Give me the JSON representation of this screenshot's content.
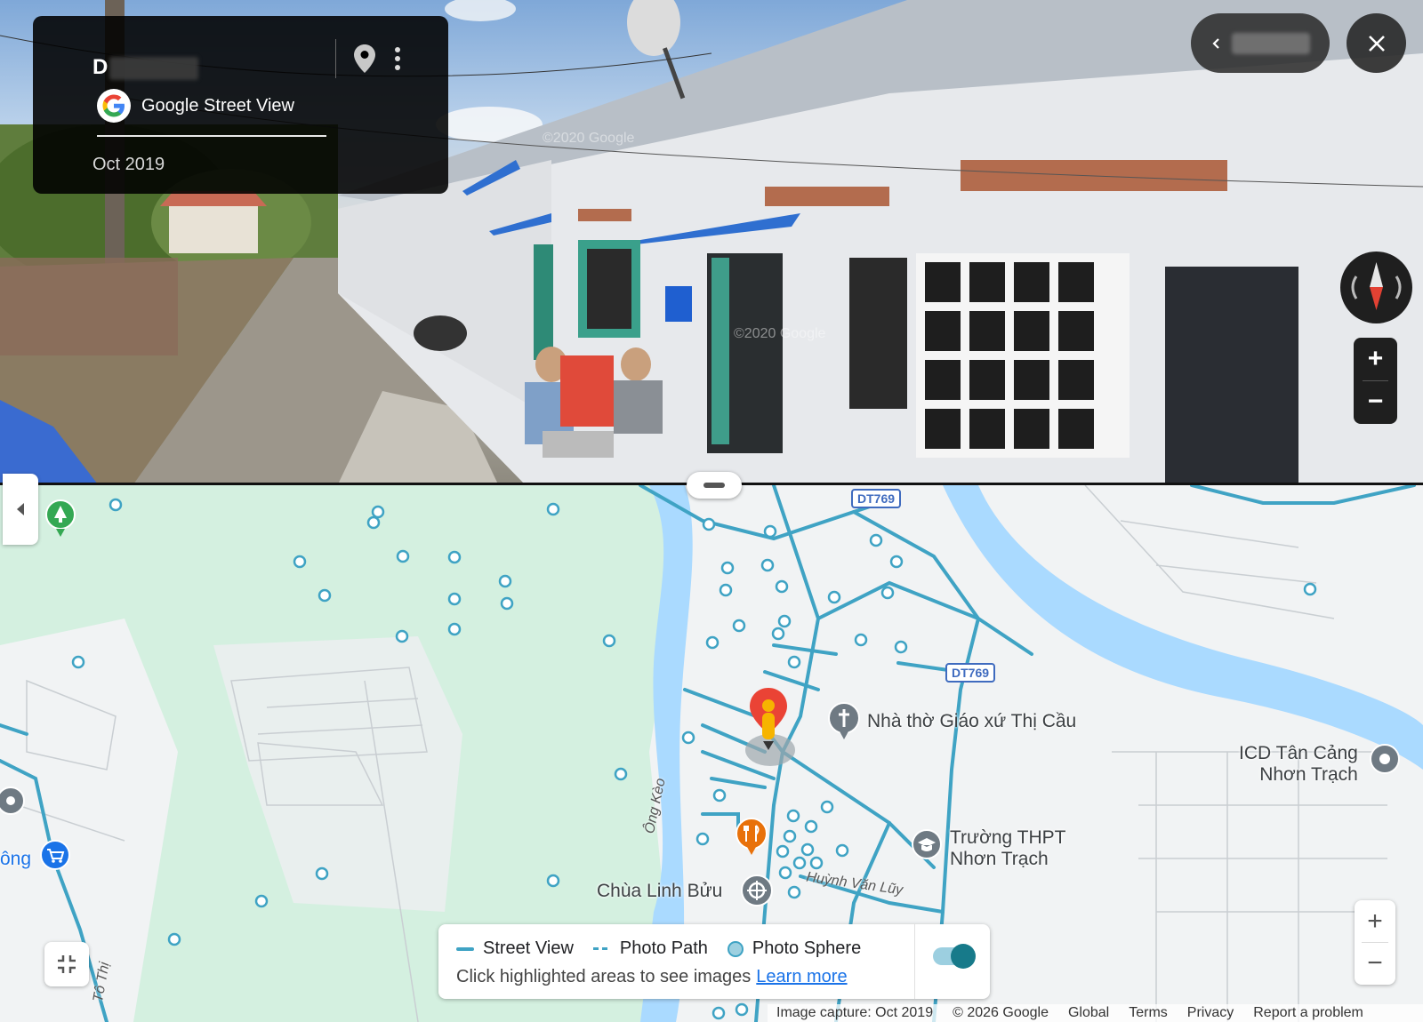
{
  "street_view": {
    "location_title": "D",
    "brand_label": "Google Street View",
    "capture_date": "Oct 2019",
    "watermarks": [
      "©2020 Google",
      "©2020 Google"
    ]
  },
  "icons": {
    "pin": "location-pin-icon",
    "more": "more-vert-icon",
    "close": "close-icon",
    "compass": "compass-icon",
    "zoom_in": "plus-icon",
    "zoom_out": "minus-icon",
    "collapse": "chevron-left-icon",
    "fullscreen": "exit-fullscreen-icon"
  },
  "pano_controls": {
    "zoom_in": "+",
    "zoom_out": "−"
  },
  "map": {
    "road_shields": [
      "DT769",
      "DT769"
    ],
    "places": [
      {
        "name": "Nhà thờ Giáo xứ Thị Cầu",
        "type": "church"
      },
      {
        "name": "ICD Tân Cảng Nhơn Trạch",
        "type": "place"
      },
      {
        "name": "Trường THPT Nhơn Trạch",
        "type": "school"
      },
      {
        "name": "Chùa Linh Bửu",
        "type": "temple"
      }
    ],
    "place_line_1": "ICD Tân Cảng",
    "place_line_2": "Nhơn Trạch",
    "school_line_1": "Trường THPT",
    "school_line_2": "Nhơn Trạch",
    "church_name": "Nhà thờ Giáo xứ Thị Cầu",
    "temple_name": "Chùa Linh Bửu",
    "road_names": [
      "Ông Kèo",
      "Huỳnh Văn Lũy",
      "Tô Thị"
    ],
    "edge_label": "ông",
    "zoom_in": "+",
    "zoom_out": "−"
  },
  "legend": {
    "items": [
      "Street View",
      "Photo Path",
      "Photo Sphere"
    ],
    "hint": "Click highlighted areas to see images",
    "learn_more": "Learn more",
    "toggle_on": true
  },
  "footer": {
    "image_capture": "Image capture: Oct 2019",
    "copyright": "© 2026 Google",
    "region": "Global",
    "terms": "Terms",
    "privacy": "Privacy",
    "report": "Report a problem"
  },
  "colors": {
    "coverage_line": "#3fa3c4",
    "river": "#aadaff",
    "green_area": "#d4f0e0",
    "map_background": "#f1f3f4",
    "link": "#1a73e8",
    "shield_border": "#3f6bbf"
  }
}
